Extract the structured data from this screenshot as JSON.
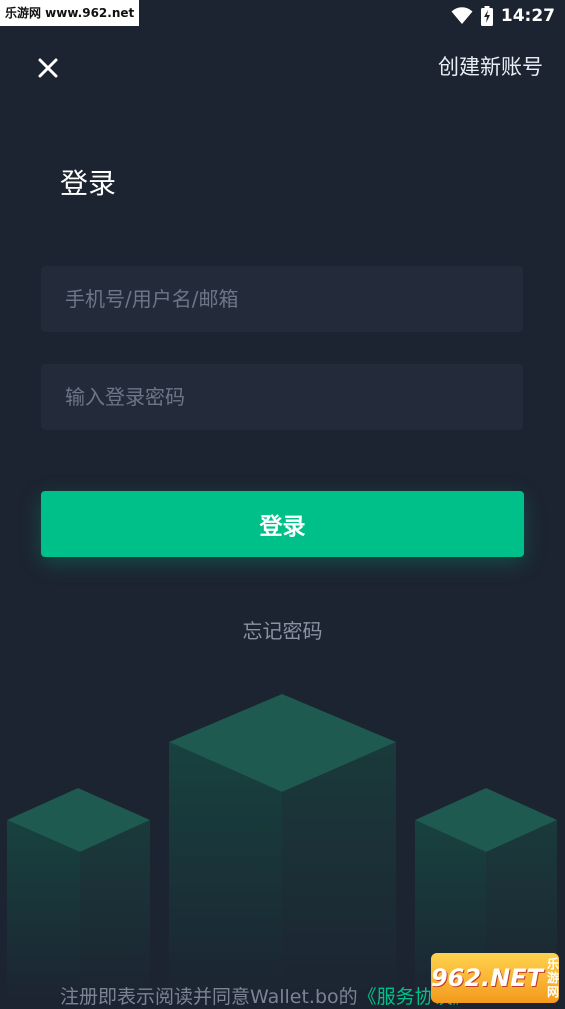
{
  "status_bar": {
    "watermark": "乐游网 www.962.net",
    "time": "14:27",
    "wifi_icon": "wifi-icon",
    "battery_icon": "battery-charging-icon"
  },
  "header": {
    "close_icon": "close-icon",
    "create_account_label": "创建新账号"
  },
  "title": "登录",
  "form": {
    "username_placeholder": "手机号/用户名/邮箱",
    "password_placeholder": "输入登录密码",
    "login_label": "登录",
    "forgot_label": "忘记密码"
  },
  "footer": {
    "prefix": "注册即表示阅读并同意Wallet.bo的",
    "link": "《服务协议》"
  },
  "overlay_logo": {
    "main": "962.NET",
    "sub": "乐游网"
  },
  "colors": {
    "background": "#1c2331",
    "accent": "#00c089",
    "field_bg": "#232b3a"
  }
}
